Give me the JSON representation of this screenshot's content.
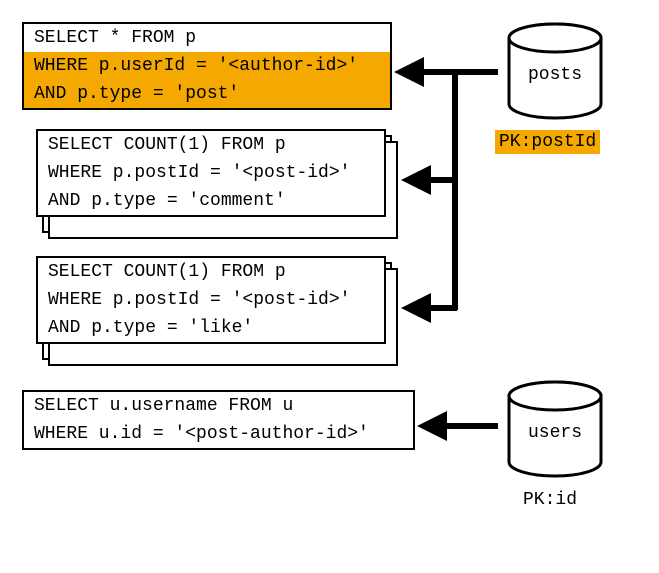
{
  "queries": {
    "q1": {
      "line1": "SELECT * FROM p",
      "line2": "WHERE p.userId = '<author-id>'",
      "line3": "AND p.type = 'post'"
    },
    "q2": {
      "line1": "SELECT COUNT(1) FROM p",
      "line2": "WHERE p.postId = '<post-id>'",
      "line3": "AND p.type = 'comment'"
    },
    "q3": {
      "line1": "SELECT COUNT(1) FROM p",
      "line2": "WHERE p.postId = '<post-id>'",
      "line3": "AND p.type = 'like'"
    },
    "q4": {
      "line1": "SELECT u.username FROM u",
      "line2": "WHERE u.id = '<post-author-id>'"
    }
  },
  "db": {
    "posts": {
      "label": "posts",
      "pk": "PK:postId"
    },
    "users": {
      "label": "users",
      "pk": "PK:id"
    }
  }
}
